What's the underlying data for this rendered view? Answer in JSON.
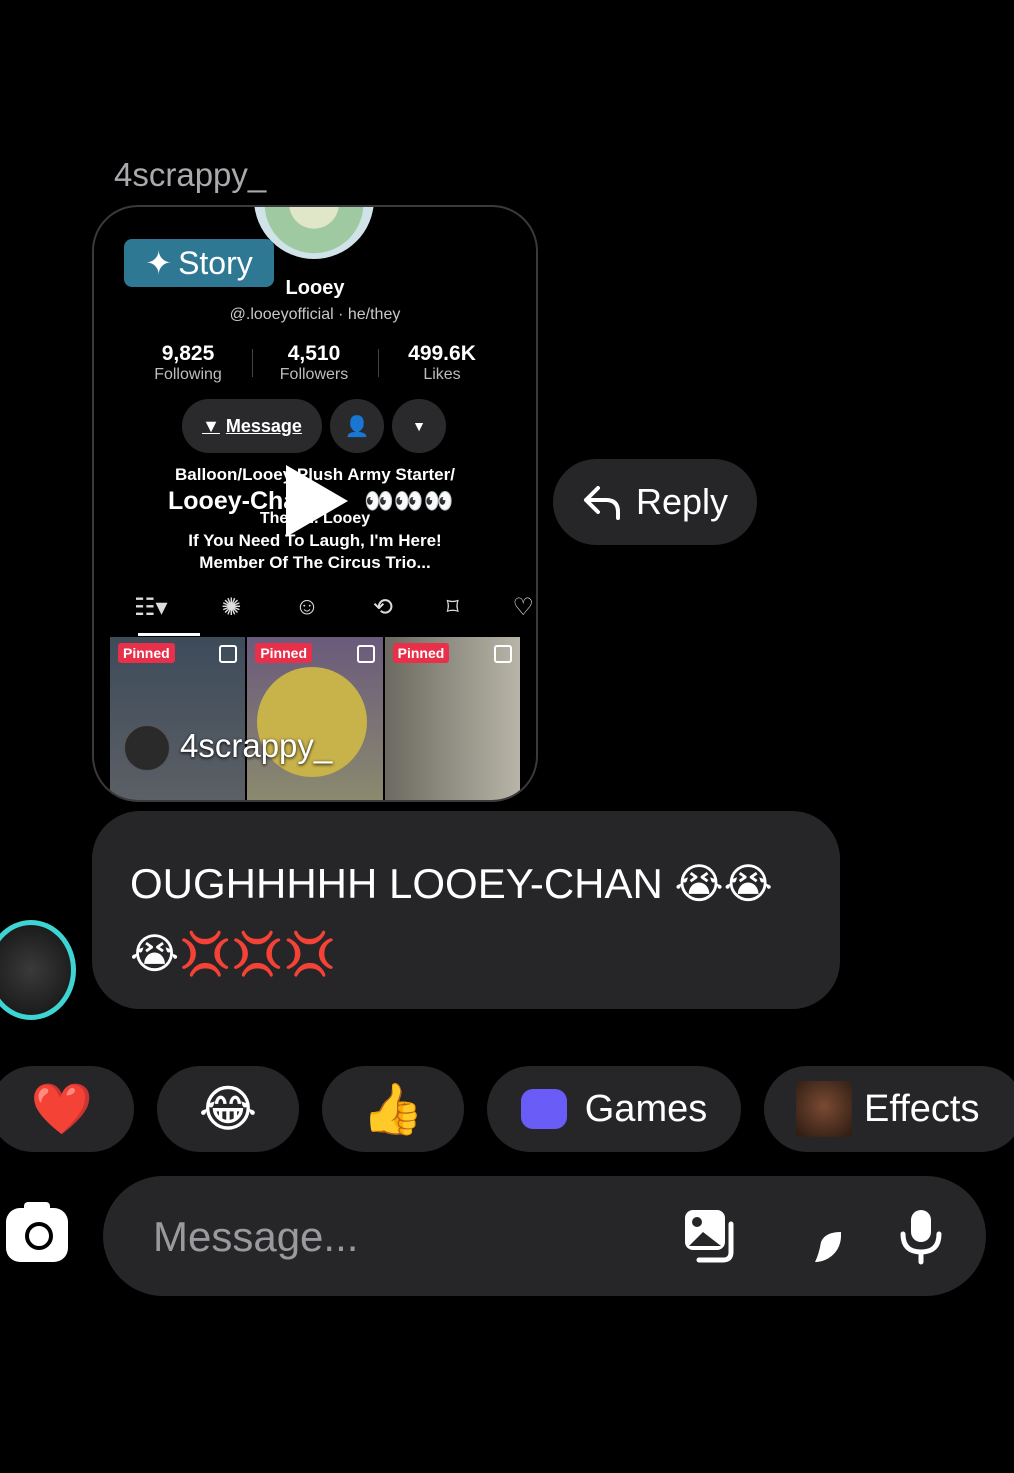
{
  "sender": "4scrappy_",
  "shared_card": {
    "story_label": "Story",
    "profile_name": "Looey",
    "profile_handle": "@.looeyofficial · he/they",
    "stats": [
      {
        "value": "9,825",
        "label": "Following"
      },
      {
        "value": "4,510",
        "label": "Followers"
      },
      {
        "value": "499.6K",
        "label": "Likes"
      }
    ],
    "message_label": "Message",
    "bio": [
      "Balloon/Looey Plush Army Starter/",
      "Looey-Chan",
      "The O... Looey",
      "If You Need To Laugh, I'm Here!",
      "Member Of The Circus Trio..."
    ],
    "bio_emojis": "👀👀👀",
    "pinned_label": "Pinned",
    "overlay_username": "4scrappy_"
  },
  "reply_label": "Reply",
  "message": {
    "text": "OUGHHHHH LOOEY-CHAN 😭😭 😭💢💢💢"
  },
  "quick_reactions": [
    "❤️",
    "😂",
    "👍"
  ],
  "games_label": "Games",
  "effects_label": "Effects",
  "composer": {
    "placeholder": "Message..."
  }
}
